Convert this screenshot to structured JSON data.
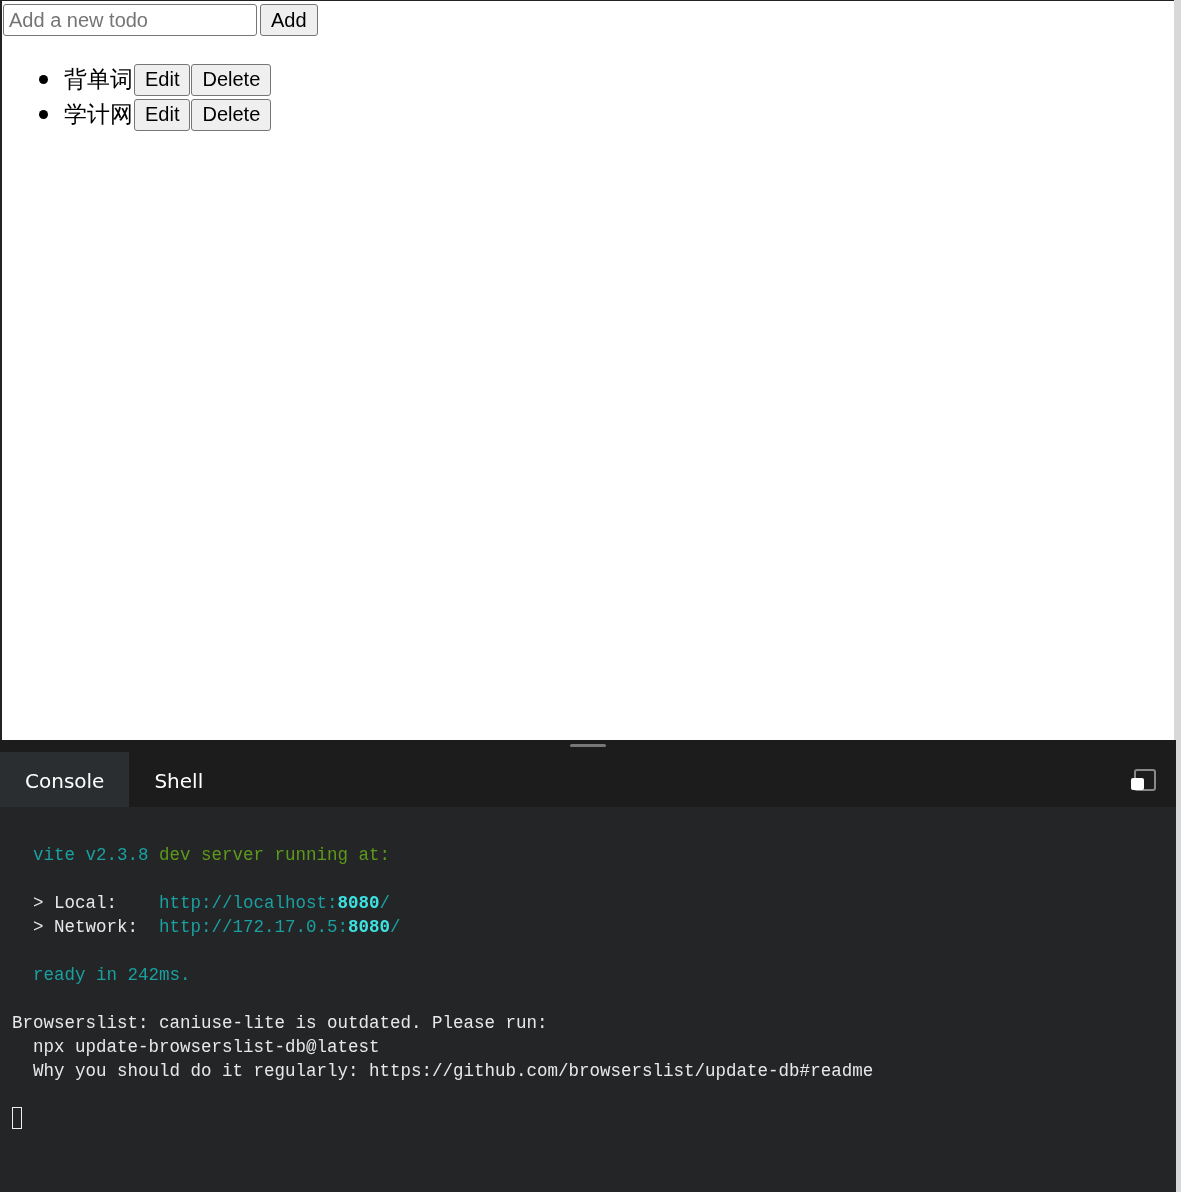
{
  "todo_app": {
    "new_todo": {
      "placeholder": "Add a new todo"
    },
    "add_button": "Add",
    "todos": [
      {
        "text": "背单词",
        "edit": "Edit",
        "delete": "Delete"
      },
      {
        "text": "学计网",
        "edit": "Edit",
        "delete": "Delete"
      }
    ]
  },
  "panel": {
    "tabs": [
      {
        "label": "Console",
        "selected": true
      },
      {
        "label": "Shell",
        "selected": false
      }
    ],
    "console_blocks": [
      {
        "lines": [
          {
            "indent": true,
            "segments": [
              {
                "kind": "cyan",
                "text": "vite v2.3.8"
              },
              {
                "kind": "green",
                "text": " dev server running at:"
              }
            ]
          }
        ]
      },
      {
        "lines": [
          {
            "indent": true,
            "segments": [
              {
                "kind": "plain",
                "text": "> Local:    "
              },
              {
                "kind": "cyan",
                "text": "http://localhost:"
              },
              {
                "kind": "bright",
                "text": "8080"
              },
              {
                "kind": "cyan",
                "text": "/"
              }
            ]
          },
          {
            "indent": true,
            "segments": [
              {
                "kind": "plain",
                "text": "> Network:  "
              },
              {
                "kind": "cyan",
                "text": "http://172.17.0.5:"
              },
              {
                "kind": "bright",
                "text": "8080"
              },
              {
                "kind": "cyan",
                "text": "/"
              }
            ]
          }
        ]
      },
      {
        "lines": [
          {
            "indent": true,
            "segments": [
              {
                "kind": "cyan",
                "text": "ready in 242ms."
              }
            ]
          }
        ]
      },
      {
        "lines": [
          {
            "indent": false,
            "segments": [
              {
                "kind": "plain",
                "text": "Browserslist: caniuse-lite is outdated. Please run:"
              }
            ]
          },
          {
            "indent": true,
            "segments": [
              {
                "kind": "plain",
                "text": "npx update-browserslist-db@latest"
              }
            ]
          },
          {
            "indent": true,
            "segments": [
              {
                "kind": "plain",
                "text": "Why you should do it regularly: https://github.com/browserslist/update-db#readme"
              }
            ]
          }
        ]
      }
    ]
  }
}
